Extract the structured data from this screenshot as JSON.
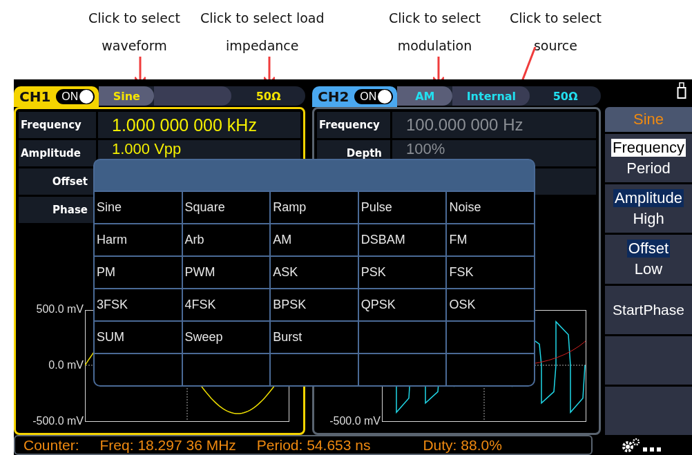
{
  "annotations": [
    {
      "text": "Click to select\nwaveform"
    },
    {
      "text": "Click to select load\nimpedance"
    },
    {
      "text": "Click to select\nmodulation"
    },
    {
      "text": "Click to select\nsource"
    }
  ],
  "channels": [
    {
      "name": "CH1",
      "color": "#f5d400",
      "on": true,
      "toggle": "ON",
      "mode": "Sine",
      "load": "50Ω",
      "params": [
        {
          "kind": "param",
          "label": "Frequency",
          "value": "1.000 000 000 kHz"
        },
        {
          "kind": "param",
          "label": "Amplitude",
          "value": "1.000 Vpp"
        },
        {
          "kind": "param",
          "label": "Offset"
        },
        {
          "kind": "param",
          "label": "Phase"
        }
      ],
      "axis": {
        "top": "500.0 mV",
        "middle": "0.0 mV",
        "bottom": "-500.0 mV"
      }
    },
    {
      "name": "CH2",
      "color": "#4aa8f0",
      "on": true,
      "toggle": "ON",
      "mode": "AM",
      "source": "Internal",
      "load": "50Ω",
      "params": [
        {
          "kind": "param",
          "label": "Frequency",
          "value": "100.000 000 Hz"
        },
        {
          "kind": "param",
          "label": "Depth",
          "value": "100%"
        },
        {
          "kind": "blank"
        }
      ],
      "axis": {
        "bottom": "-500.0 mV"
      }
    }
  ],
  "popup": {
    "items": [
      "Sine",
      "Square",
      "Ramp",
      "Pulse",
      "Noise",
      "Harm",
      "Arb",
      "AM",
      "DSBAM",
      "FM",
      "PM",
      "PWM",
      "ASK",
      "PSK",
      "FSK",
      "3FSK",
      "4FSK",
      "BPSK",
      "QPSK",
      "OSK",
      "SUM",
      "Sweep",
      "Burst"
    ]
  },
  "menu": {
    "title": "Sine",
    "items": [
      {
        "kind": "options",
        "options": [
          {
            "label": "Frequency",
            "selected": true,
            "focused": true
          },
          {
            "label": "Period",
            "selected": false,
            "focused": false
          }
        ]
      },
      {
        "kind": "options",
        "options": [
          {
            "label": "Amplitude",
            "selected": true,
            "focused": false
          },
          {
            "label": "High",
            "selected": false,
            "focused": false
          }
        ]
      },
      {
        "kind": "options",
        "options": [
          {
            "label": "Offset",
            "selected": true,
            "focused": false
          },
          {
            "label": "Low",
            "selected": false,
            "focused": false
          }
        ]
      },
      {
        "kind": "options",
        "options": [
          {
            "label": "StartPhase",
            "selected": false,
            "focused": false
          }
        ]
      },
      {
        "kind": "blank"
      },
      {
        "kind": "blank"
      }
    ]
  },
  "status_bar": {
    "counter": "Counter:",
    "freq": "Freq: 18.297 36 MHz",
    "period": "Period: 54.653 ns",
    "duty": "Duty: 88.0%"
  }
}
